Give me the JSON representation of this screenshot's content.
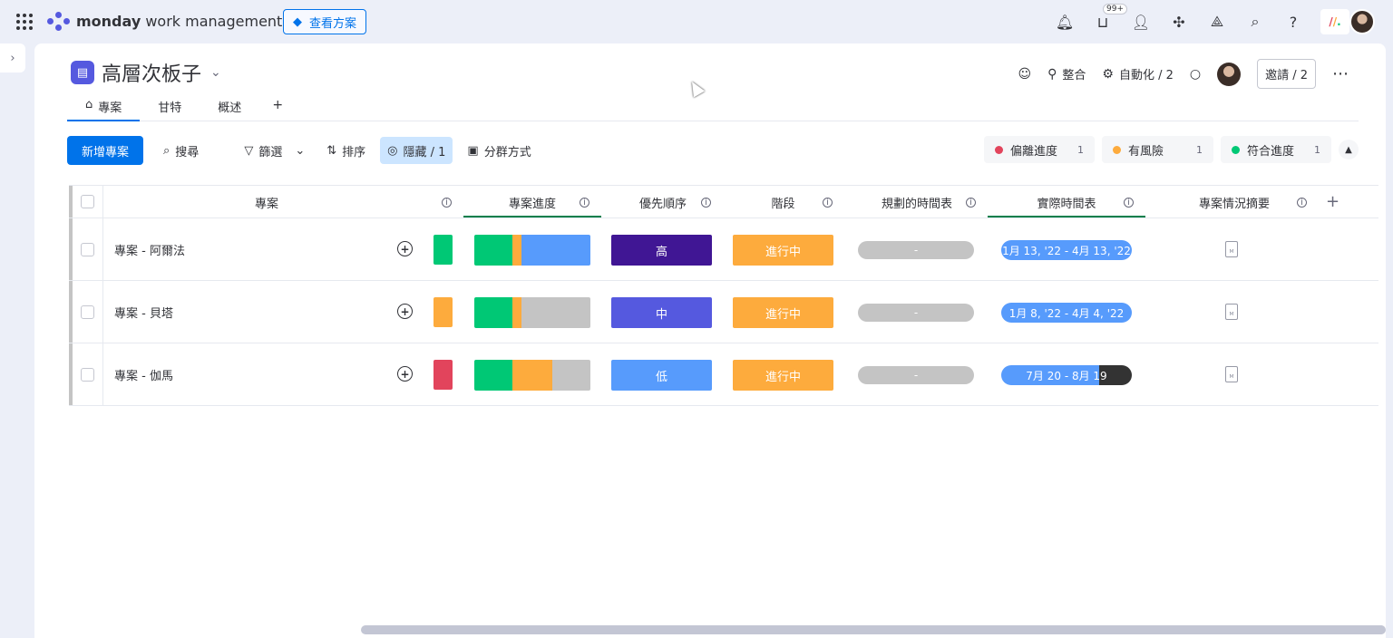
{
  "topbar": {
    "brand_bold": "monday",
    "brand_rest": " work management",
    "plans_label": "查看方案",
    "inbox_badge": "99+",
    "help": "?"
  },
  "board": {
    "title": "高層次板子",
    "integrate_label": "整合",
    "automate_label": "自動化 / 2",
    "invite_label": "邀請 / 2"
  },
  "tabs": [
    {
      "label": "專案"
    },
    {
      "label": "甘特"
    },
    {
      "label": "概述"
    }
  ],
  "tab_add": "+",
  "toolbar": {
    "new_label": "新增專案",
    "search_label": "搜尋",
    "filter_label": "篩選",
    "sort_label": "排序",
    "hide_label": "隱藏 / 1",
    "group_label": "分群方式"
  },
  "status_chips": [
    {
      "label": "偏離進度",
      "count": "1",
      "color": "#e2445c"
    },
    {
      "label": "有風險",
      "count": "1",
      "color": "#fdab3d"
    },
    {
      "label": "符合進度",
      "count": "1",
      "color": "#00c875"
    }
  ],
  "columns": {
    "name": "專案",
    "progress": "專案進度",
    "priority": "優先順序",
    "stage": "階段",
    "planned": "規劃的時間表",
    "actual": "實際時間表",
    "summary": "專案情況摘要"
  },
  "rows": [
    {
      "name": "專案 - 阿爾法",
      "status_color": "#00c875",
      "progress": [
        {
          "color": "#00c875",
          "pct": 33
        },
        {
          "color": "#fdab3d",
          "pct": 8
        },
        {
          "color": "#579bfc",
          "pct": 59
        }
      ],
      "priority": "高",
      "priority_color": "#401694",
      "stage": "進行中",
      "stage_color": "#fdab3d",
      "planned": "-",
      "actual": "1月 13, '22 - 4月 13, '22",
      "actual_fill_pct": 100
    },
    {
      "name": "專案 - 貝塔",
      "status_color": "#fdab3d",
      "progress": [
        {
          "color": "#00c875",
          "pct": 33
        },
        {
          "color": "#fdab3d",
          "pct": 8
        },
        {
          "color": "#c4c4c4",
          "pct": 59
        }
      ],
      "priority": "中",
      "priority_color": "#5559df",
      "stage": "進行中",
      "stage_color": "#fdab3d",
      "planned": "-",
      "actual": "1月 8, '22 - 4月 4, '22",
      "actual_fill_pct": 100
    },
    {
      "name": "專案 - 伽馬",
      "status_color": "#e2445c",
      "progress": [
        {
          "color": "#00c875",
          "pct": 33
        },
        {
          "color": "#fdab3d",
          "pct": 34
        },
        {
          "color": "#c4c4c4",
          "pct": 33
        }
      ],
      "priority": "低",
      "priority_color": "#579bfc",
      "stage": "進行中",
      "stage_color": "#fdab3d",
      "planned": "-",
      "actual": "7月 20 - 8月 19",
      "actual_fill_pct": 75
    }
  ],
  "colors": {
    "accent": "#0073ea",
    "group_line": "#037f4c"
  }
}
